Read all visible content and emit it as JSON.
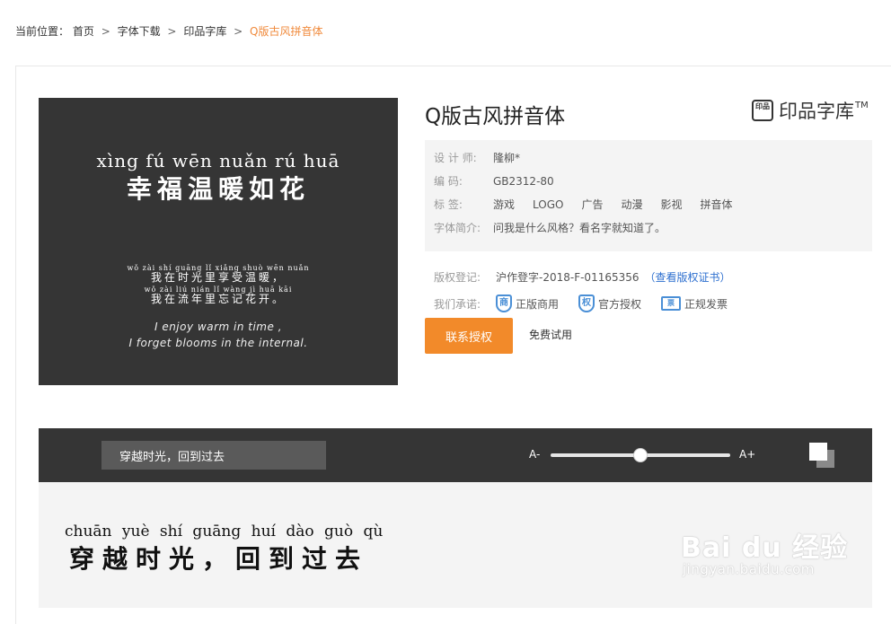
{
  "breadcrumb": {
    "prefix": "当前位置：",
    "items": [
      "首页",
      "字体下载",
      "印品字库"
    ],
    "separator": ">",
    "current": "Q版古风拼音体"
  },
  "preview": {
    "pinyin_big": "xìng  fú  wēn nuǎn  rú  huā",
    "hanzi_big": "幸福温暖如花",
    "poem": [
      {
        "py": "wǒ zài shí guāng lǐ xiǎng shuò wēn nuǎn",
        "hz": "我在时光里享受温暖，"
      },
      {
        "py": "wǒ zài liú nián lǐ wàng jì huā kāi",
        "hz": "我在流年里忘记花开。"
      }
    ],
    "en_line1": "I enjoy warm in time ,",
    "en_line2": "I forget blooms in the internal."
  },
  "font": {
    "title": "Q版古风拼音体",
    "brand_name": "印品字库",
    "brand_tm": "TM",
    "brand_logo_text": "印品"
  },
  "info": {
    "designer_label": "设  计  师:",
    "designer": "隆柳*",
    "code_label": "编        码:",
    "code": "GB2312-80",
    "tags_label": "标        签:",
    "tags": [
      "游戏",
      "LOGO",
      "广告",
      "动漫",
      "影视",
      "拼音体"
    ],
    "intro_label": "字体简介:",
    "intro": "问我是什么风格？看名字就知道了。"
  },
  "legal": {
    "copyright_label": "版权登记:",
    "copyright": "沪作登字-2018-F-01165356",
    "copyright_link": "（查看版权证书）",
    "promise_label": "我们承诺:",
    "promises": [
      {
        "icon_text": "商",
        "label": "正版商用"
      },
      {
        "icon_text": "权",
        "label": "官方授权"
      },
      {
        "icon_text": "票",
        "label": "正规发票"
      }
    ]
  },
  "actions": {
    "buy": "联系授权",
    "try": "免费试用"
  },
  "toolbar": {
    "sample_text": "穿越时光，回到过去",
    "a_minus": "A-",
    "a_plus": "A+",
    "size_level": 0.5
  },
  "sample": {
    "pinyin": "chuān yuè  shí guāng     huí  dào  guò  qù",
    "hanzi": "穿越时光，回到过去"
  },
  "watermark": {
    "main": "Bai du 经验",
    "sub": "jingyan.baidu.com"
  }
}
